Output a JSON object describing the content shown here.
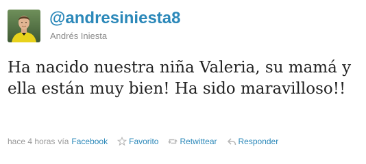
{
  "tweet": {
    "handle": "@andresiniesta8",
    "full_name": "Andrés Iniesta",
    "text": "Ha nacido nuestra niña Valeria, su mamá y ella están muy bien! Ha sido maravilloso!!",
    "timestamp": "hace 4 horas",
    "via_label": "vía",
    "source": "Facebook"
  },
  "actions": {
    "favorite_label": "Favorito",
    "retweet_label": "Retwittear",
    "reply_label": "Responder"
  },
  "colors": {
    "link": "#2b88b9",
    "meta": "#999999",
    "text": "#222222"
  },
  "icons": {
    "favorite": "star-icon",
    "retweet": "retweet-icon",
    "reply": "reply-icon"
  }
}
